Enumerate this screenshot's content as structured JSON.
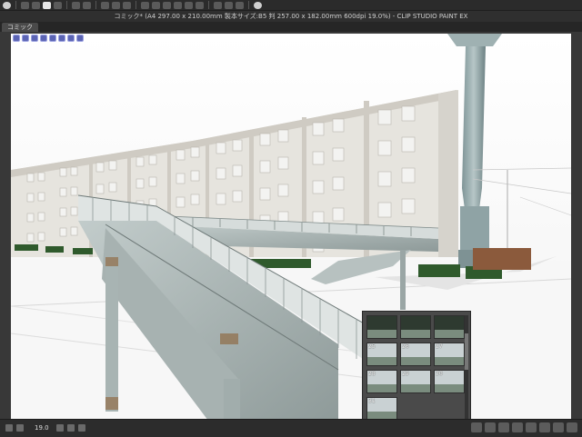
{
  "window": {
    "title": "コミック* (A4 297.00 x 210.00mm 製本サイズ:B5 判 257.00 x 182.00mm 600dpi 19.0%) - CLIP STUDIO PAINT EX",
    "tab_label": "コミック"
  },
  "statusbar": {
    "zoom": "19.0"
  },
  "thumbnails": {
    "items": [
      {
        "label": ""
      },
      {
        "label": ""
      },
      {
        "label": ""
      },
      {
        "label": "25"
      },
      {
        "label": "26"
      },
      {
        "label": "27"
      },
      {
        "label": "28"
      },
      {
        "label": "29"
      },
      {
        "label": "30"
      },
      {
        "label": "31"
      }
    ]
  },
  "colors": {
    "accent": "#5b64b4",
    "building_wall": "#e4e2dc",
    "bridge_steel": "#aeb8b6",
    "rust": "#8a5a2a",
    "hedge": "#2f5a2c",
    "tower": "#8ea3a4"
  }
}
